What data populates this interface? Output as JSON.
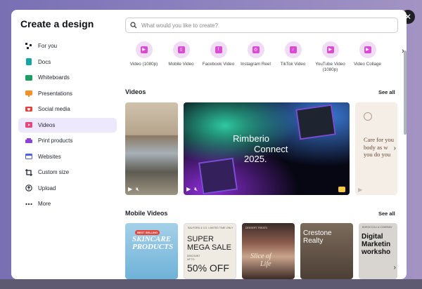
{
  "modal": {
    "title": "Create a design",
    "close_icon": "close-icon"
  },
  "sidebar": {
    "items": [
      {
        "label": "For you",
        "icon": "sparkle-icon",
        "color": "#1f2430"
      },
      {
        "label": "Docs",
        "icon": "doc-icon",
        "color": "#17a6a6"
      },
      {
        "label": "Whiteboards",
        "icon": "whiteboard-icon",
        "color": "#1e9e63"
      },
      {
        "label": "Presentations",
        "icon": "presentation-icon",
        "color": "#f0912b"
      },
      {
        "label": "Social media",
        "icon": "heart-icon",
        "color": "#e6423b"
      },
      {
        "label": "Videos",
        "icon": "video-icon",
        "color": "#e4487b",
        "active": true
      },
      {
        "label": "Print products",
        "icon": "printer-icon",
        "color": "#8f43d6"
      },
      {
        "label": "Websites",
        "icon": "website-icon",
        "color": "#4f5ee6"
      },
      {
        "label": "Custom size",
        "icon": "crop-icon",
        "color": "#1f2430"
      },
      {
        "label": "Upload",
        "icon": "cloud-upload-icon",
        "color": "#1f2430"
      },
      {
        "label": "More",
        "icon": "more-dots-icon",
        "color": "#1f2430"
      }
    ]
  },
  "search": {
    "placeholder": "What would you like to create?"
  },
  "types": [
    {
      "label": "Video (1080p)",
      "glyph": "▶"
    },
    {
      "label": "Mobile Video",
      "glyph": "▯"
    },
    {
      "label": "Facebook Video",
      "glyph": "f"
    },
    {
      "label": "Instagram Reel",
      "glyph": "◎"
    },
    {
      "label": "TikTok Video",
      "glyph": "♪"
    },
    {
      "label": "YouTube Video\n(1080p)",
      "glyph": "▶"
    },
    {
      "label": "Video Collage",
      "glyph": "▶"
    }
  ],
  "sections": {
    "videos": {
      "title": "Videos",
      "see_all": "See all"
    },
    "mobile": {
      "title": "Mobile Videos",
      "see_all": "See all"
    }
  },
  "video_thumbs": {
    "rimberio": {
      "line1": "Rimberio",
      "line2": "Connect",
      "line3": "2025."
    },
    "care": {
      "lines": [
        "Care for you",
        "body as w",
        "you do you"
      ]
    }
  },
  "mobile_thumbs": {
    "skincare": {
      "tag": "BEST SELLING",
      "line1": "SKINCARE",
      "line2": "PRODUCTS"
    },
    "sale": {
      "head": "SALFORD & CO.   LIMITED TIME ONLY",
      "super": "SUPER",
      "mega": "MEGA SALE",
      "disc1": "DISCOUNT",
      "disc2": "UP TO",
      "pct": "50% OFF"
    },
    "slice": {
      "head": "DESSERT TREATS",
      "line1": "Slice of",
      "line2": "Life"
    },
    "crestone": {
      "line1": "Crestone",
      "line2": "Realty"
    },
    "marketing": {
      "head": "BOROCCOLI & COMPANY",
      "line1": "Digital",
      "line2": "Marketin",
      "line3": "worksho"
    }
  }
}
